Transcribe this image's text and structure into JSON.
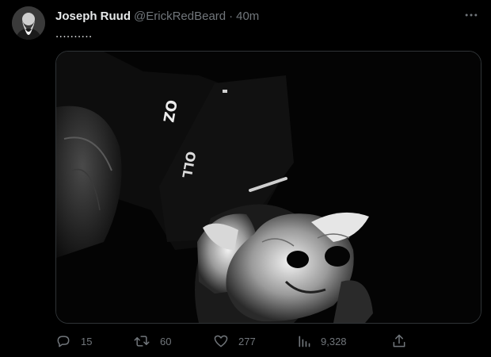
{
  "tweet": {
    "author": {
      "display_name": "Joseph Ruud",
      "handle": "@ErickRedBeard"
    },
    "separator": "·",
    "timestamp": "40m",
    "text": "..........",
    "media": {
      "image_text": [
        "OZ",
        "OLL"
      ]
    },
    "actions": {
      "replies": "15",
      "retweets": "60",
      "likes": "277",
      "views": "9,328"
    }
  },
  "icons": {
    "more": "more-horizontal-icon",
    "reply": "reply-icon",
    "retweet": "retweet-icon",
    "like": "heart-icon",
    "views": "views-icon",
    "share": "share-icon"
  },
  "colors": {
    "background": "#000000",
    "primary_text": "#e7e9ea",
    "secondary_text": "#71767b",
    "border": "#2f3336"
  }
}
